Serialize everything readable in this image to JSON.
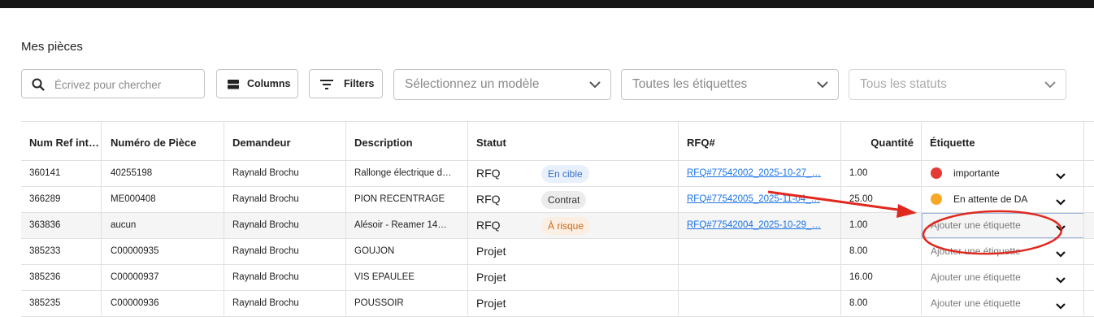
{
  "page": {
    "title": "Mes pièces"
  },
  "toolbar": {
    "search_placeholder": "Écrivez pour chercher",
    "columns_label": "Columns",
    "filters_label": "Filters",
    "model_select": "Sélectionnez un modèle",
    "tags_select": "Toutes les étiquettes",
    "status_select": "Tous les statuts"
  },
  "table": {
    "headers": [
      "Num Ref int…",
      "Numéro de Pièce",
      "Demandeur",
      "Description",
      "Statut",
      "RFQ#",
      "Quantité",
      "Étiquette"
    ],
    "rows": [
      {
        "ref": "360141",
        "part": "40255198",
        "requester": "Raynald Brochu",
        "desc": "Rallonge électrique d…",
        "status": "RFQ",
        "chip": "En cible",
        "rfq": "RFQ#77542002_2025-10-27_…",
        "qty": "1.00",
        "tag": "importante",
        "tag_color": "#e53935"
      },
      {
        "ref": "366289",
        "part": "ME000408",
        "requester": "Raynald Brochu",
        "desc": "PION RECENTRAGE",
        "status": "RFQ",
        "chip": "Contrat",
        "rfq": "RFQ#77542005_2025-11-04_…",
        "qty": "25.00",
        "tag": "En attente de DA",
        "tag_color": "#f9a825"
      },
      {
        "ref": "363836",
        "part": "aucun",
        "requester": "Raynald Brochu",
        "desc": "Alésoir - Reamer 14…",
        "status": "RFQ",
        "chip": "À risque",
        "rfq": "RFQ#77542004_2025-10-29_…",
        "qty": "1.00",
        "tag": "Ajouter une étiquette"
      },
      {
        "ref": "385233",
        "part": "C00000935",
        "requester": "Raynald Brochu",
        "desc": "GOUJON",
        "status": "Projet",
        "qty": "8.00",
        "tag": "Ajouter une étiquette"
      },
      {
        "ref": "385236",
        "part": "C00000937",
        "requester": "Raynald Brochu",
        "desc": "VIS EPAULEE",
        "status": "Projet",
        "qty": "16.00",
        "tag": "Ajouter une étiquette"
      },
      {
        "ref": "385235",
        "part": "C00000936",
        "requester": "Raynald Brochu",
        "desc": "POUSSOIR",
        "status": "Projet",
        "qty": "8.00",
        "tag": "Ajouter une étiquette"
      }
    ]
  },
  "colors": {
    "annotation": "#e0281e",
    "link": "#1a73e8"
  }
}
